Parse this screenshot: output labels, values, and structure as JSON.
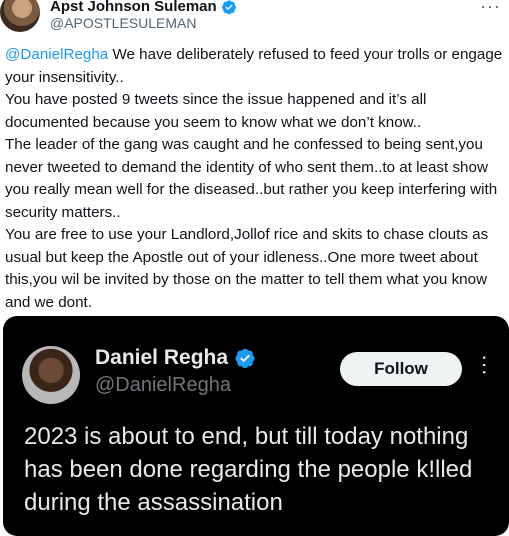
{
  "author": {
    "display_name": "Apst Johnson Suleman",
    "handle": "@APOSTLESULEMAN"
  },
  "menu": {
    "more_label": "···"
  },
  "tweet": {
    "mention": "@DanielRegha",
    "line1_rest": " We have deliberately refused to feed your trolls or engage your insensitivity..",
    "line2": "You have posted 9 tweets since the issue happened and it’s all documented because you seem to know what we don’t know..",
    "line3": "The leader of the gang was caught and he confessed to being sent,you never tweeted to demand the identity of who sent them..to at least show you really mean well for the diseased..but rather you keep interfering with security matters..",
    "line4": "You are free to use your Landlord,Jollof rice and skits to chase clouts as usual but keep the Apostle out of  your  idleness..One more tweet about this,you wil be invited by those on the matter to tell them what you know and we dont."
  },
  "quoted": {
    "display_name": "Daniel Regha",
    "handle": "@DanielRegha",
    "follow_label": "Follow",
    "more_label": "···",
    "text": "2023 is about to end, but till today nothing has been done regarding the people k!lled during the assassination"
  },
  "colors": {
    "accent": "#1d9bf0",
    "verified": "#1d9bf0",
    "quote_bg": "#000000"
  },
  "icons": {
    "verified": "verified-badge-icon",
    "more": "more-horizontal-icon"
  }
}
